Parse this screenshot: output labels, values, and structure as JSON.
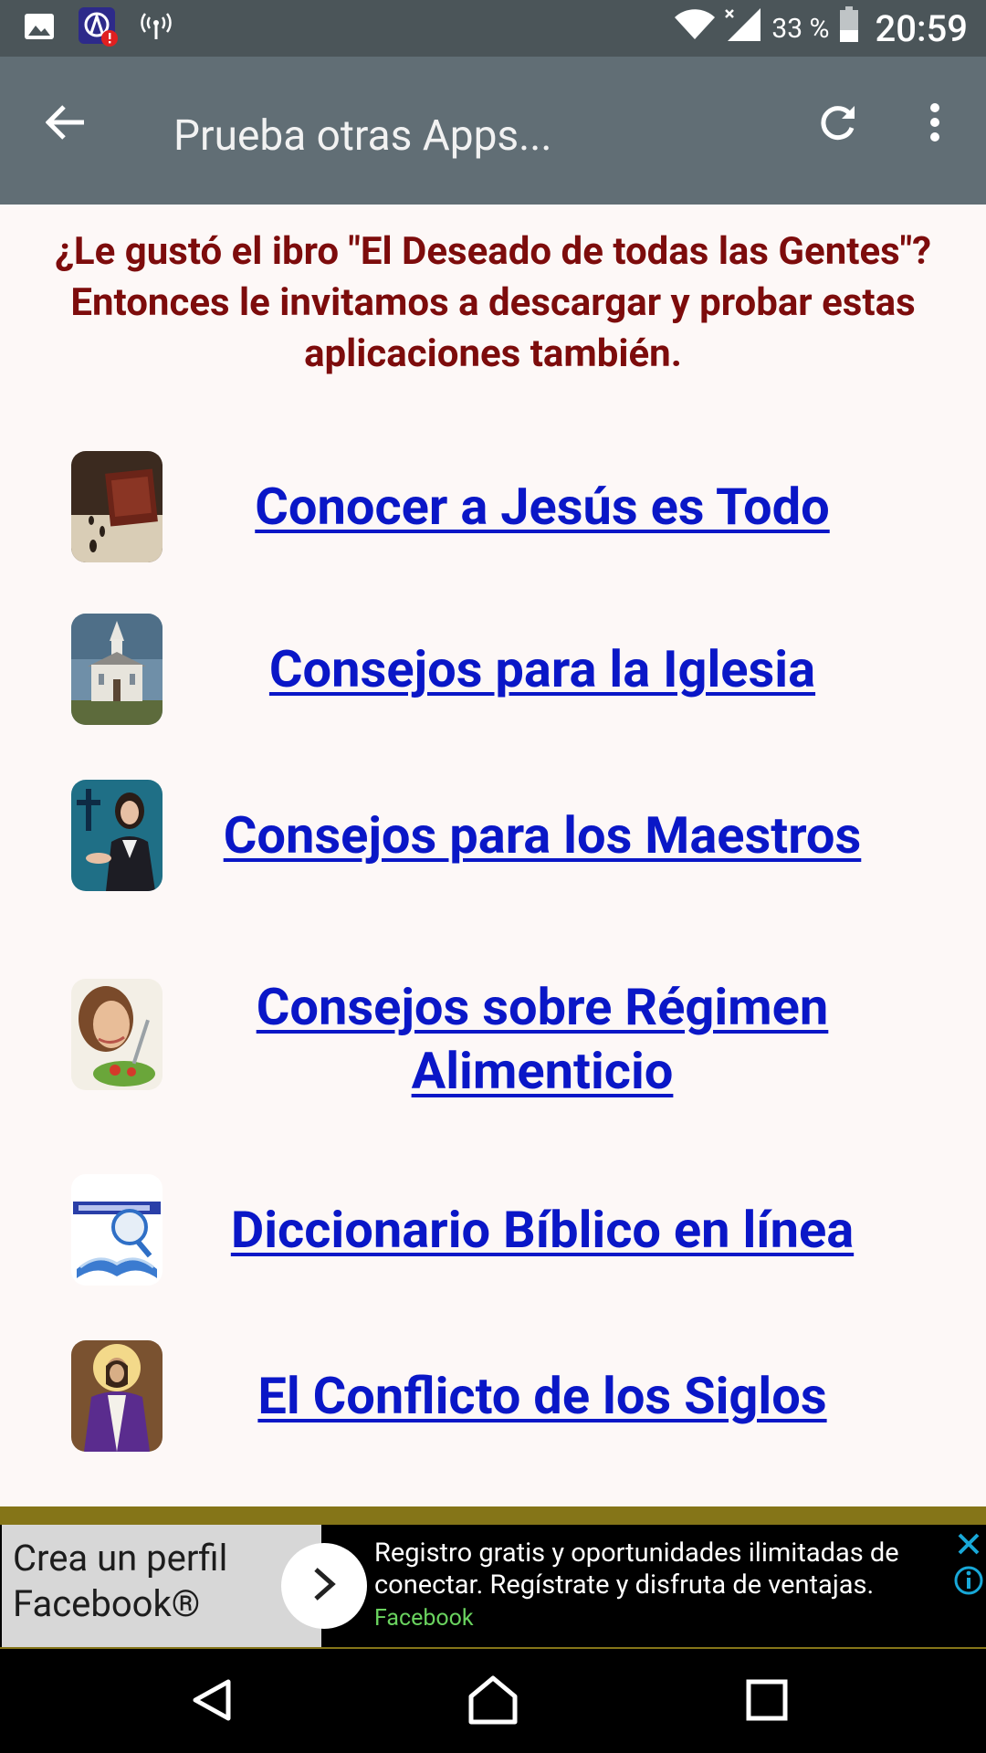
{
  "status_bar": {
    "icons": [
      "image-icon",
      "app-alert-icon",
      "broadcast-icon",
      "wifi-icon",
      "signal-icon",
      "battery-icon"
    ],
    "battery": "33 %",
    "time": "20:59"
  },
  "app_bar": {
    "title": "Prueba otras Apps...",
    "back_icon": "arrow-back-icon",
    "refresh_icon": "refresh-icon",
    "more_icon": "more-vert-icon"
  },
  "intro": "¿Le gustó el ibro \"El Deseado de todas las Gentes\"? Entonces le invitamos a descargar y probar estas aplicaciones también.",
  "apps": [
    {
      "label": "Conocer a Jesús es Todo",
      "icon": "book-cover-icon"
    },
    {
      "label": "Consejos para la Iglesia",
      "icon": "church-icon"
    },
    {
      "label": "Consejos para los Maestros",
      "icon": "teacher-icon"
    },
    {
      "label": "Consejos sobre Régimen Alimenticio",
      "icon": "salad-icon"
    },
    {
      "label": "Diccionario Bíblico en línea",
      "icon": "dictionary-icon"
    },
    {
      "label": "El Conflicto de los Siglos",
      "icon": "jesus-icon"
    }
  ],
  "ad": {
    "left_text": "Crea un perfil Facebook®",
    "description": "Registro gratis y oportunidades ilimitadas de conectar. Regístrate y disfruta de ventajas.",
    "source": "Facebook"
  },
  "nav_bar": {
    "icons": [
      "nav-back-icon",
      "nav-home-icon",
      "nav-recents-icon"
    ]
  },
  "colors": {
    "status_bar": "#4b5559",
    "app_bar": "#616e75",
    "intro_text": "#7d0c0c",
    "link": "#0a17c7",
    "ad_accent": "#857518"
  }
}
